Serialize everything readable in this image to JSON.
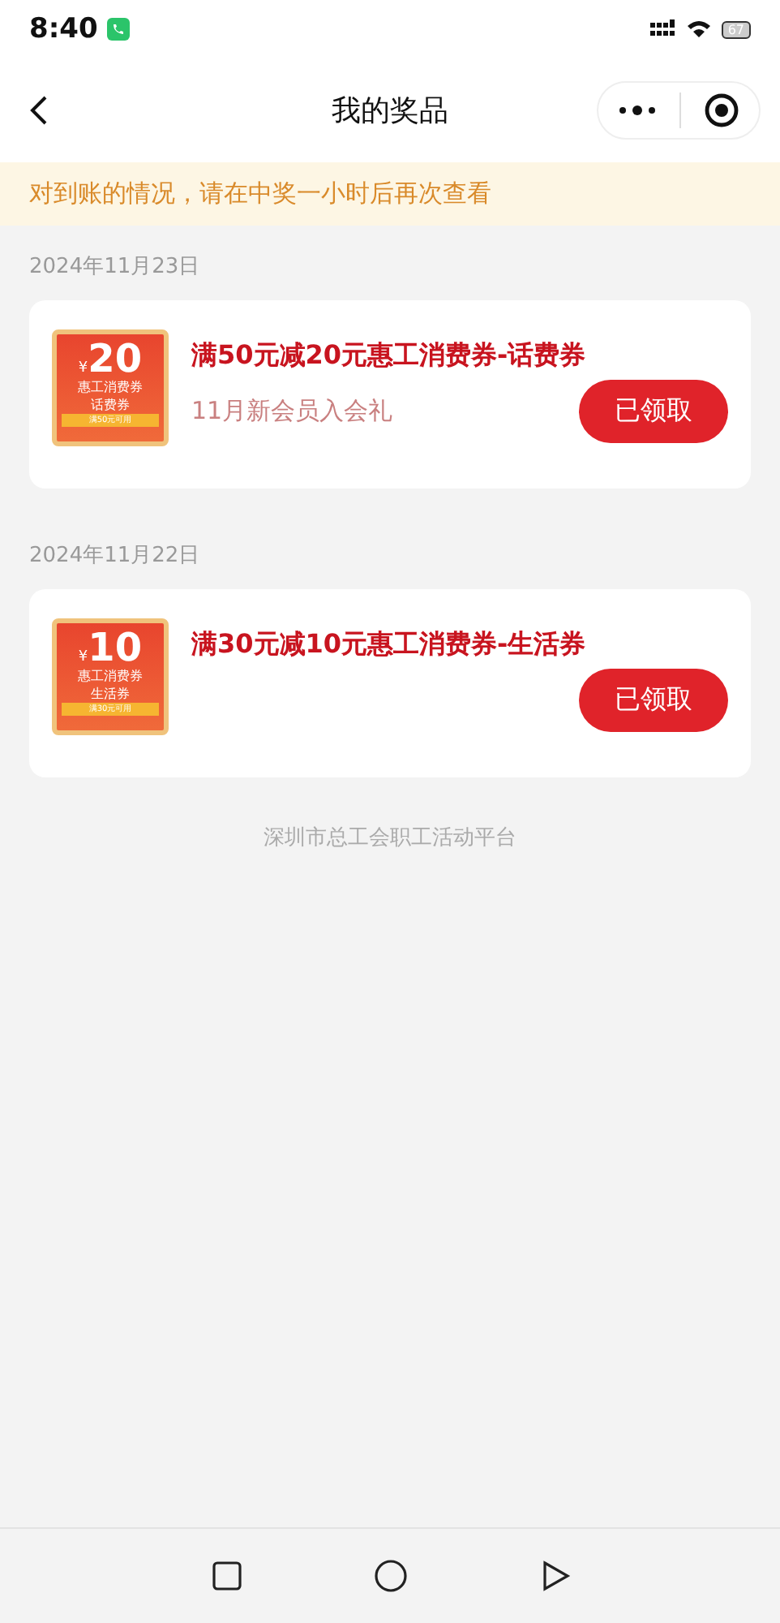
{
  "status_bar": {
    "time": "8:40",
    "battery": "67"
  },
  "header": {
    "title": "我的奖品"
  },
  "notice": {
    "text": "对到账的情况，请在中奖一小时后再次查看"
  },
  "groups": [
    {
      "date": "2024年11月23日",
      "prizes": [
        {
          "currency": "¥",
          "amount": "20",
          "coupon_name": "惠工消费券",
          "coupon_type": "话费券",
          "condition": "满50元可用",
          "title": "满50元减20元惠工消费券-话费券",
          "subtitle": "11月新会员入会礼",
          "button": "已领取"
        }
      ]
    },
    {
      "date": "2024年11月22日",
      "prizes": [
        {
          "currency": "¥",
          "amount": "10",
          "coupon_name": "惠工消费券",
          "coupon_type": "生活券",
          "condition": "满30元可用",
          "title": "满30元减10元惠工消费券-生活券",
          "button": "已领取"
        }
      ]
    }
  ],
  "footer": "深圳市总工会职工活动平台"
}
